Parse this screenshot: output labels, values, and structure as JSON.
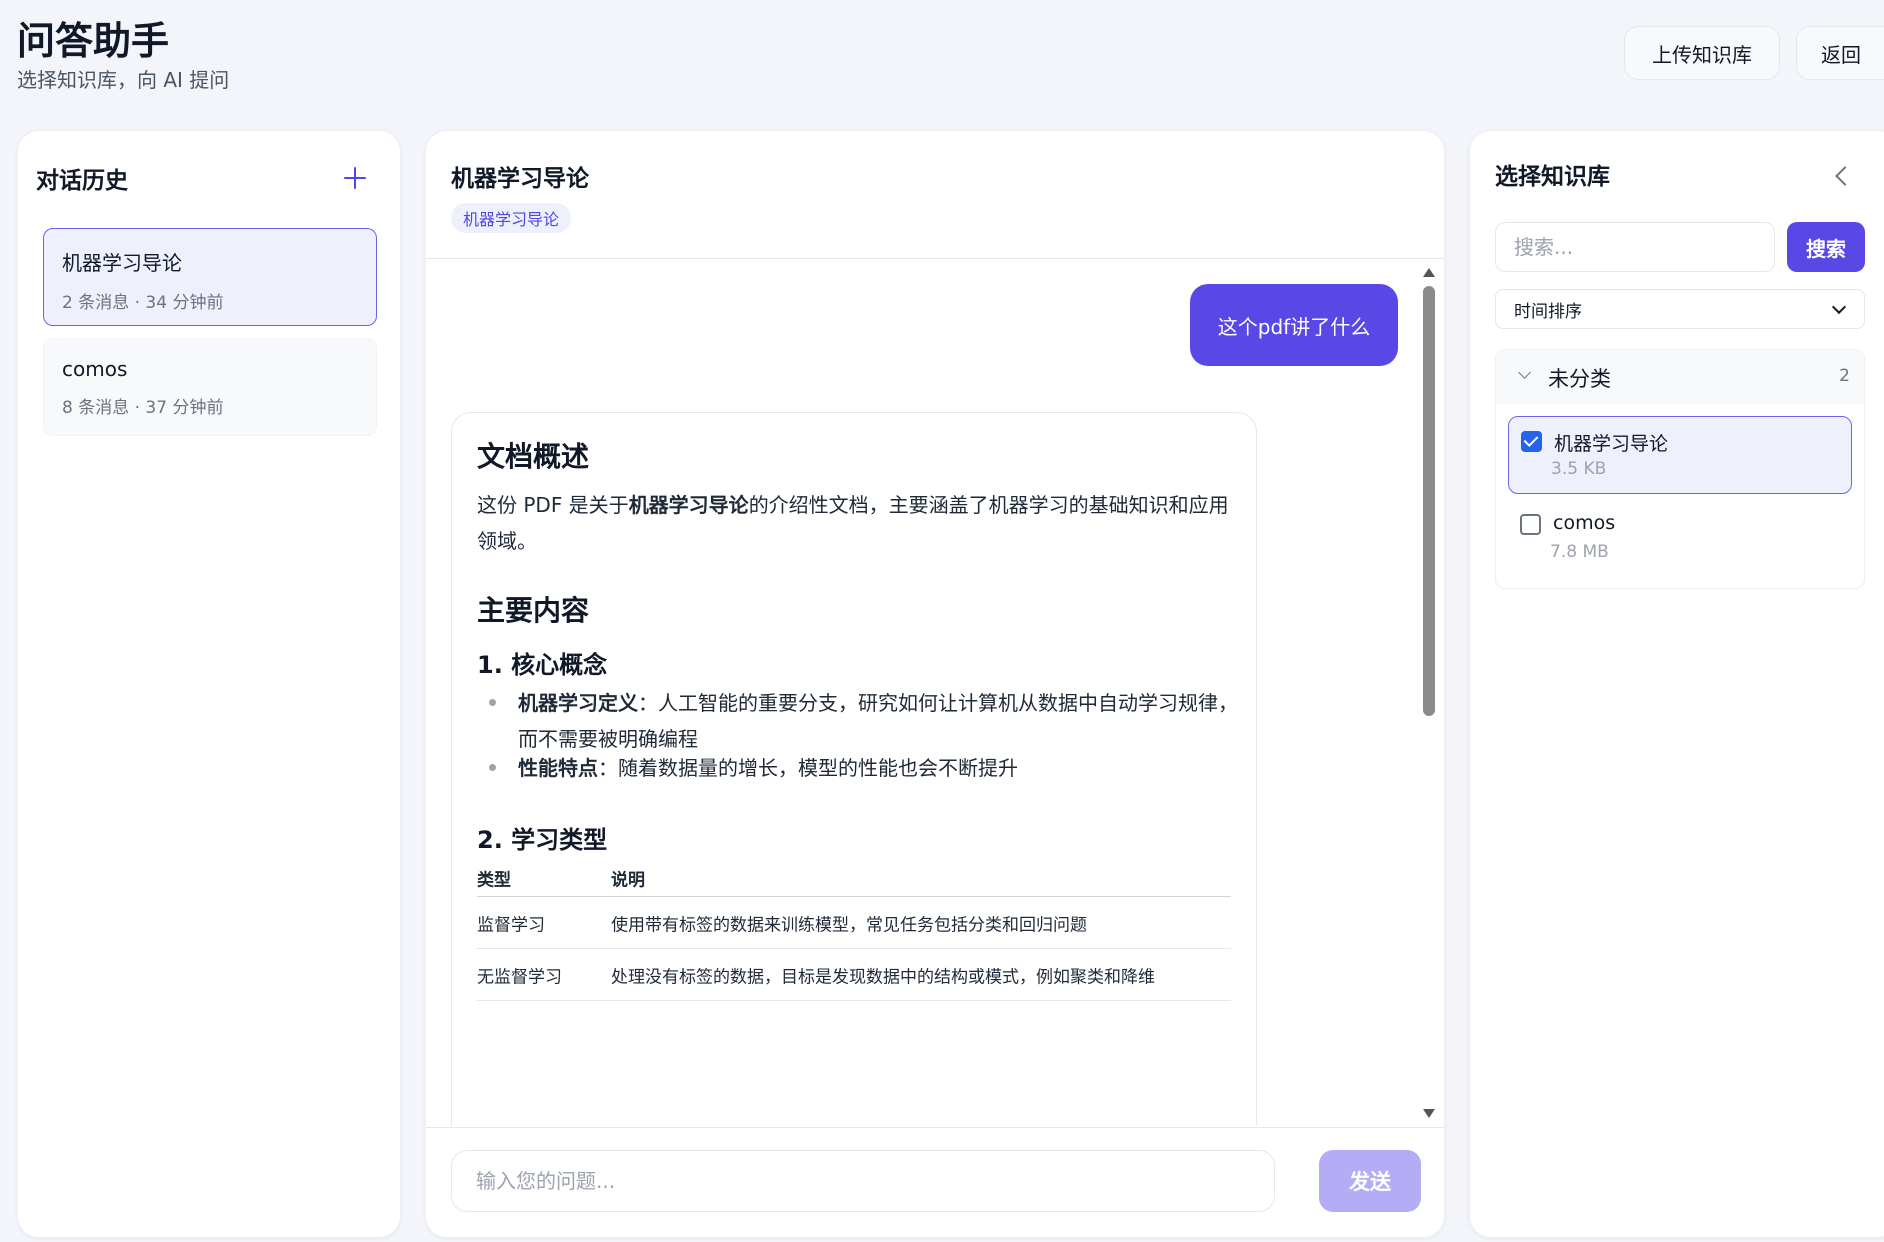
{
  "app": {
    "title": "问答助手",
    "subtitle": "选择知识库，向 AI 提问",
    "upload_label": "上传知识库",
    "back_label": "返回"
  },
  "history": {
    "title": "对话历史",
    "items": [
      {
        "name": "机器学习导论",
        "meta": "2 条消息 · 34 分钟前"
      },
      {
        "name": "comos",
        "meta": "8 条消息 · 37 分钟前"
      }
    ]
  },
  "chat": {
    "title": "机器学习导论",
    "tag": "机器学习导论",
    "user_message": "这个pdf讲了什么",
    "answer": {
      "h1_overview": "文档概述",
      "intro_prefix": "这份 PDF 是关于",
      "intro_bold": "机器学习导论",
      "intro_suffix": "的介绍性文档，主要涵盖了机器学习的基础知识和应用领域。",
      "h1_main": "主要内容",
      "h3_core": "1. 核心概念",
      "bullets": [
        {
          "bold": "机器学习定义",
          "text": "：人工智能的重要分支，研究如何让计算机从数据中自动学习规律，而不需要被明确编程"
        },
        {
          "bold": "性能特点",
          "text": "：随着数据量的增长，模型的性能也会不断提升"
        }
      ],
      "h3_types": "2. 学习类型",
      "table": {
        "headers": [
          "类型",
          "说明"
        ],
        "rows": [
          [
            "监督学习",
            "使用带有标签的数据来训练模型，常见任务包括分类和回归问题"
          ],
          [
            "无监督学习",
            "处理没有标签的数据，目标是发现数据中的结构或模式，例如聚类和降维"
          ]
        ]
      }
    },
    "input_placeholder": "输入您的问题...",
    "send_label": "发送"
  },
  "kb": {
    "title": "选择知识库",
    "search_placeholder": "搜索...",
    "search_label": "搜索",
    "sort_label": "时间排序",
    "group": {
      "name": "未分类",
      "count": "2",
      "items": [
        {
          "name": "机器学习导论",
          "size": "3.5 KB",
          "checked": true
        },
        {
          "name": "comos",
          "size": "7.8 MB",
          "checked": false
        }
      ]
    }
  },
  "colors": {
    "accent": "#5a48e6",
    "accent_light": "#eef0fc",
    "send_disabled": "#b4adf5",
    "checkbox": "#2563eb"
  },
  "icons": [
    "plus-icon",
    "chevron-left-icon",
    "chevron-down-icon",
    "checkbox-icon",
    "scroll-up-icon",
    "scroll-down-icon"
  ]
}
